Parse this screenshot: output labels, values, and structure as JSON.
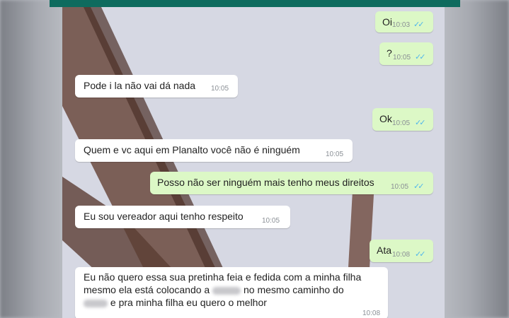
{
  "messages": [
    {
      "id": "m1",
      "dir": "out",
      "text": "Oi",
      "time": "10:03",
      "ticks": "✓✓"
    },
    {
      "id": "m2",
      "dir": "out",
      "text": "?",
      "time": "10:05",
      "ticks": "✓✓"
    },
    {
      "id": "m3",
      "dir": "in",
      "text": "Pode i la não vai dá nada",
      "time": "10:05"
    },
    {
      "id": "m4",
      "dir": "out",
      "text": "Ok",
      "time": "10:05",
      "ticks": "✓✓"
    },
    {
      "id": "m5",
      "dir": "in",
      "text": "Quem e vc aqui em Planalto você não é ninguém",
      "time": "10:05"
    },
    {
      "id": "m6",
      "dir": "out",
      "text": "Posso não ser ninguém mais tenho meus direitos",
      "time": "10:05",
      "ticks": "✓✓"
    },
    {
      "id": "m7",
      "dir": "in",
      "text": "Eu sou vereador aqui tenho respeito",
      "time": "10:05"
    },
    {
      "id": "m8",
      "dir": "out",
      "text": "Ata",
      "time": "10:08",
      "ticks": "✓✓"
    },
    {
      "id": "m9",
      "dir": "in",
      "line1": "Eu não quero essa sua pretinha feia e fedida com a minha filha",
      "line2a": "mesmo ela está colocando a",
      "line2b": "no mesmo caminho do",
      "line3": "e pra minha filha eu quero o melhor",
      "time": "10:08"
    }
  ]
}
